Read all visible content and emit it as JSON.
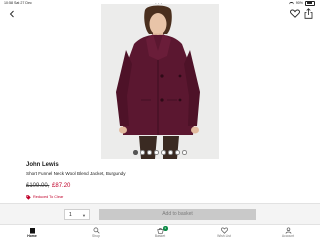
{
  "status_bar": {
    "time": "10:58",
    "date": "Sat 27 Dec",
    "battery": "90%"
  },
  "top_bar": {
    "back_icon": "chevron-left-icon",
    "wishlist_icon": "heart-icon",
    "share_icon": "share-icon"
  },
  "product": {
    "brand": "John Lewis",
    "name": "Short Funnel Neck Wool Blend Jacket, Burgundy",
    "price_was": "£109.00,",
    "price_now": "£87.20",
    "reduced_label": "Reduced To Clear",
    "image_dot_count": 8,
    "active_dot": 0
  },
  "basket_bar": {
    "quantity": "1",
    "add_label": "Add to basket"
  },
  "tabs": [
    {
      "label": "Home",
      "icon": "home-icon",
      "active": true
    },
    {
      "label": "Shop",
      "icon": "search-icon",
      "active": false
    },
    {
      "label": "Basket",
      "icon": "basket-icon",
      "active": false,
      "badge": "1"
    },
    {
      "label": "Wish List",
      "icon": "heart-icon",
      "active": false
    },
    {
      "label": "Account",
      "icon": "person-icon",
      "active": false
    }
  ],
  "colors": {
    "accent_red": "#c0002a",
    "badge_green": "#0a8a45",
    "jacket": "#5b1730",
    "button_grey": "#c9c9c9"
  }
}
